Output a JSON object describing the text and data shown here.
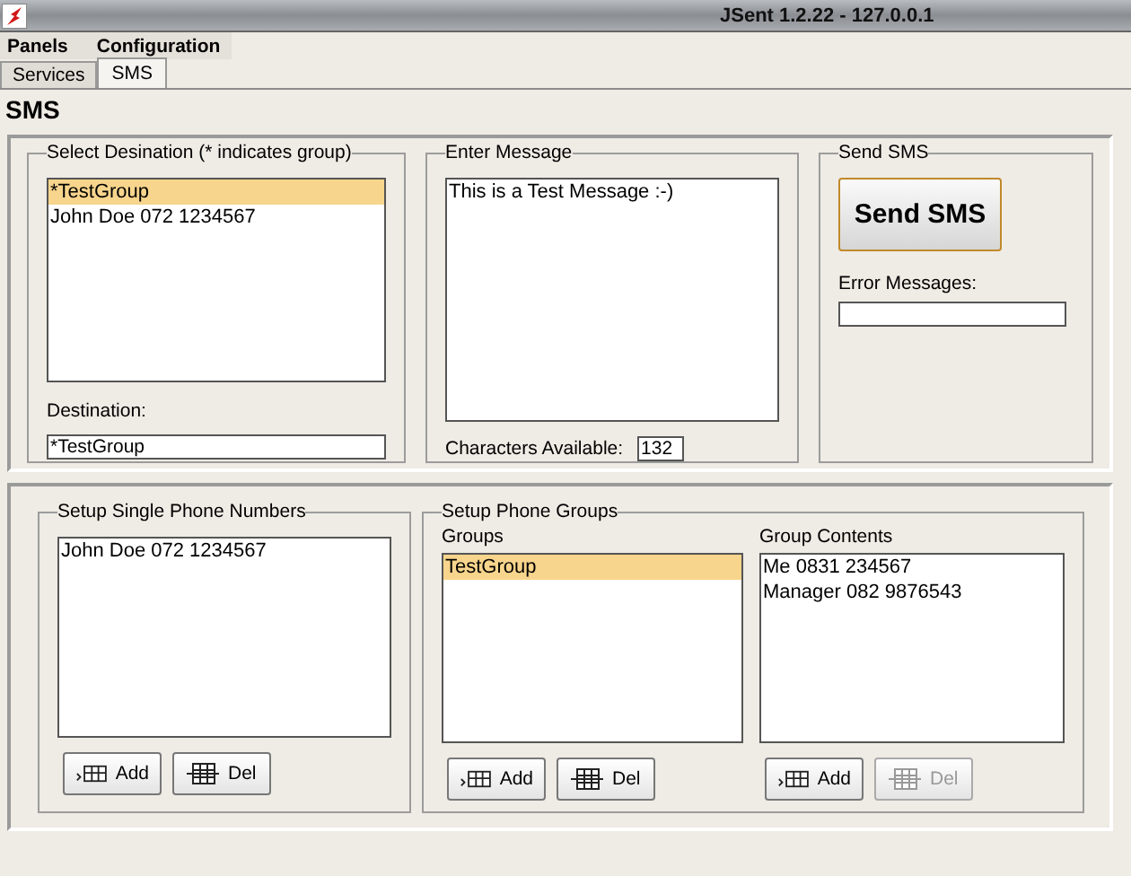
{
  "window": {
    "title": "JSent 1.2.22 - 127.0.0.1"
  },
  "menu": [
    "Panels",
    "Configuration"
  ],
  "tabs": [
    {
      "label": "Services",
      "selected": false
    },
    {
      "label": "SMS",
      "selected": true
    }
  ],
  "heading": "SMS",
  "destination": {
    "title": "Select Desination (* indicates group)",
    "items": [
      {
        "label": "*TestGroup",
        "selected": true
      },
      {
        "label": "John Doe 072 1234567",
        "selected": false
      }
    ],
    "field_label": "Destination:",
    "field_value": "*TestGroup"
  },
  "message": {
    "title": "Enter Message",
    "value": "This is a Test Message :-)",
    "count_label": "Characters Available:",
    "count_value": "132"
  },
  "send": {
    "title": "Send SMS",
    "button": "Send SMS",
    "error_label": "Error Messages:"
  },
  "single": {
    "title": "Setup Single Phone Numbers",
    "items": [
      {
        "label": "John Doe 072 1234567",
        "selected": false
      }
    ],
    "buttons": [
      {
        "kind": "add",
        "label": "Add",
        "disabled": false
      },
      {
        "kind": "del",
        "label": "Del",
        "disabled": false
      }
    ]
  },
  "phone_groups": {
    "title": "Setup Phone Groups",
    "groups": {
      "label": "Groups",
      "items": [
        {
          "label": "TestGroup",
          "selected": true
        }
      ],
      "buttons": [
        {
          "kind": "add",
          "label": "Add",
          "disabled": false
        },
        {
          "kind": "del",
          "label": "Del",
          "disabled": false
        }
      ]
    },
    "contents": {
      "label": "Group Contents",
      "items": [
        {
          "label": "Me 0831 234567",
          "selected": false
        },
        {
          "label": "Manager 082 9876543",
          "selected": false
        }
      ],
      "buttons": [
        {
          "kind": "add",
          "label": "Add",
          "disabled": false
        },
        {
          "kind": "del",
          "label": "Del",
          "disabled": true
        }
      ]
    }
  }
}
